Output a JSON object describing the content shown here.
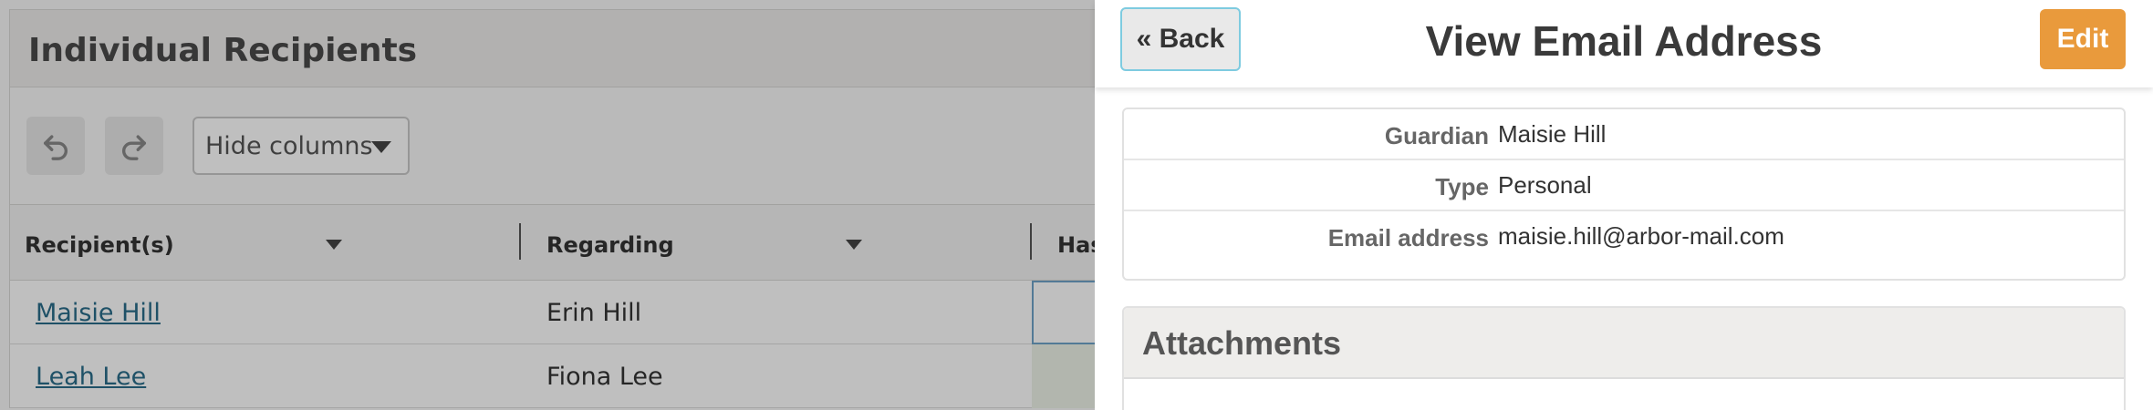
{
  "background": {
    "title": "Individual Recipients",
    "toolbar": {
      "undo_icon": "undo-icon",
      "redo_icon": "redo-icon",
      "hide_columns_label": "Hide columns"
    },
    "table": {
      "columns": [
        "Recipient(s)",
        "Regarding",
        "Has"
      ],
      "rows": [
        {
          "recipient": "Maisie Hill",
          "regarding": "Erin Hill"
        },
        {
          "recipient": "Leah Lee",
          "regarding": "Fiona Lee"
        }
      ]
    }
  },
  "panel": {
    "back_label": "« Back",
    "title": "View Email Address",
    "edit_label": "Edit",
    "details": [
      {
        "label": "Guardian",
        "value": "Maisie Hill"
      },
      {
        "label": "Type",
        "value": "Personal"
      },
      {
        "label": "Email address",
        "value": "maisie.hill@arbor-mail.com"
      }
    ],
    "attachments_title": "Attachments"
  },
  "colors": {
    "edit_button": "#e99a3c",
    "back_button_border": "#7ecbe0",
    "link": "#2a6c8a"
  }
}
